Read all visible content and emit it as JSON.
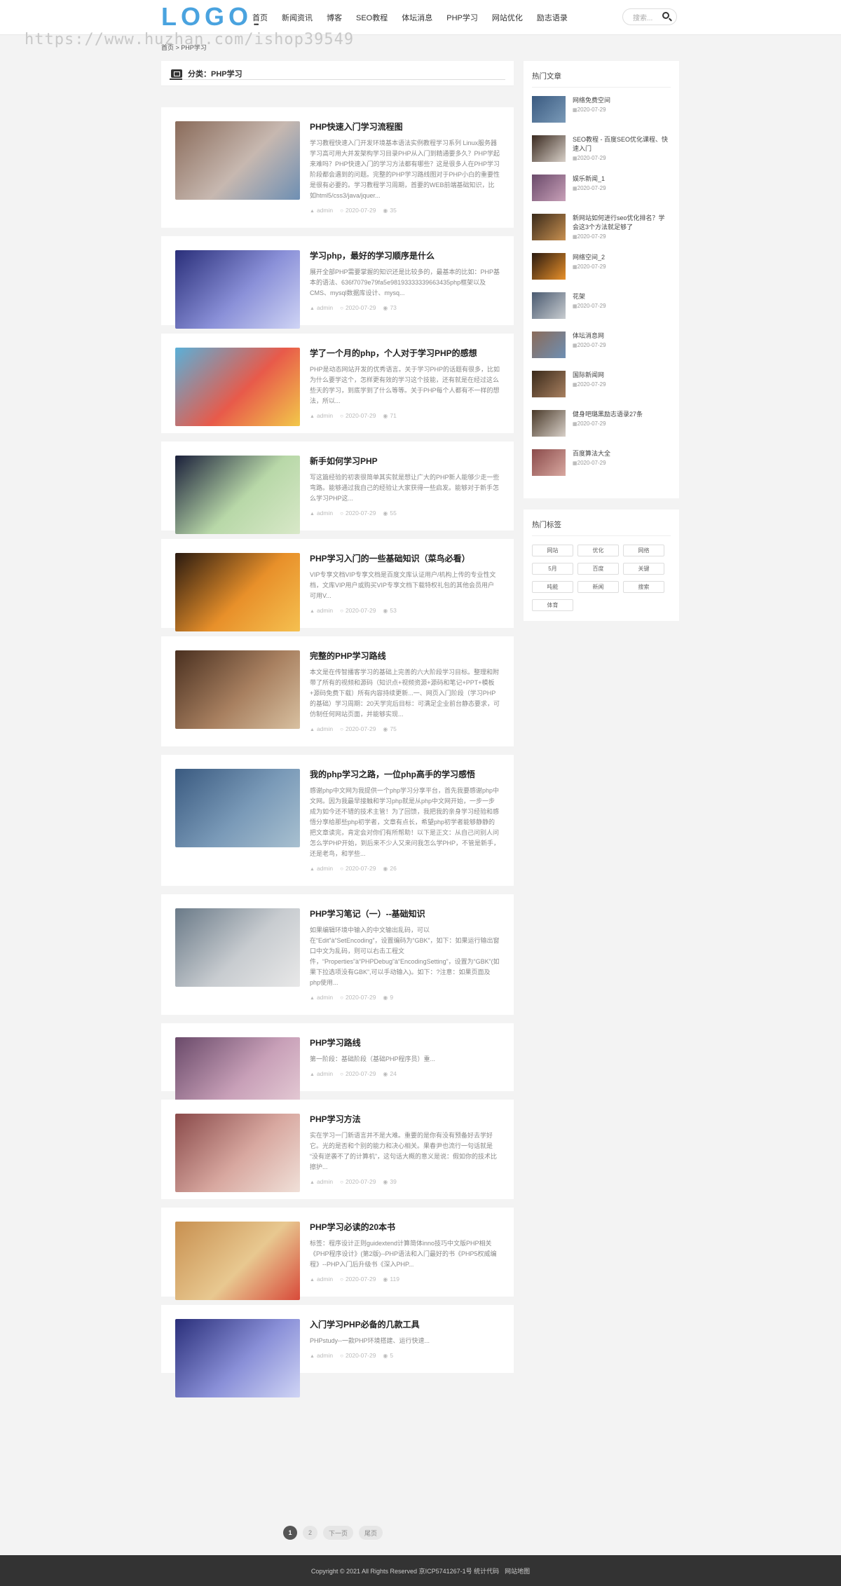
{
  "header": {
    "logo": "LOGO",
    "nav": [
      "首页",
      "新闻资讯",
      "博客",
      "SEO教程",
      "体坛消息",
      "PHP学习",
      "网站优化",
      "励志语录"
    ],
    "search_placeholder": "搜索..."
  },
  "watermark": "https://www.huzhan.com/ishop39549",
  "breadcrumb": "首页 > PHP学习",
  "category": {
    "title": "分类：PHP学习"
  },
  "posts": [
    {
      "title": "PHP快速入门学习流程图",
      "excerpt": "学习教程快速入门开发环境基本语法实例教程学习系列 Linux服务器学习高可用大并发架构学习目录PHP从入门到精通要多久？PHP学起来难吗？PHP快速入门的学习方法都有哪些？这是很多人在PHP学习阶段都会遇到的问题。完整的PHP学习路线图对于PHP小白的重要性是很有必要的。学习教程学习周期，首要的WEB前端基础知识，比如html5/css3/java/jquer...",
      "author": "admin",
      "date": "2020-07-29",
      "views": "35",
      "colors": [
        "#8a6b5a",
        "#c7b8b0",
        "#6e8fb3"
      ]
    },
    {
      "title": "学习php，最好的学习顺序是什么",
      "excerpt": "展开全部PHP需要掌握的知识还是比较多的，最基本的比如：PHP基本的语法、636f7079e79fa5e98193333339663435php框架以及CMS、mysql数据库设计、mysq...",
      "author": "admin",
      "date": "2020-07-29",
      "views": "73",
      "colors": [
        "#2a2f7a",
        "#8a90d8",
        "#cfd4f5"
      ]
    },
    {
      "title": "学了一个月的php，个人对于学习PHP的感想",
      "excerpt": "PHP是动态网站开发的优秀语言。关于学习PHP的话题有很多，比如为什么要学这个，怎样更有效的学习这个技能，还有就是在经过这么些天的学习，到底学到了什么等等。关于PHP每个人都有不一样的想法，所以...",
      "author": "admin",
      "date": "2020-07-29",
      "views": "71",
      "colors": [
        "#5ab0d8",
        "#e85a4a",
        "#f2c84a"
      ]
    },
    {
      "title": "新手如何学习PHP",
      "excerpt": "写这篇经验的初衷很简单其实就是想让广大的PHP新人能够少走一些弯路。能够通过我自己的经验让大家获得一些启发。能够对于新手怎么学习PHP这...",
      "author": "admin",
      "date": "2020-07-29",
      "views": "55",
      "colors": [
        "#1a1f3a",
        "#b8d8a8",
        "#d8e8c8"
      ]
    },
    {
      "title": "PHP学习入门的一些基础知识（菜鸟必看）",
      "excerpt": "VIP专享文档VIP专享文档是百度文库认证用户/机构上传的专业性文档，文库VIP用户或购买VIP专享文档下载特权礼包的其他会员用户可用V...",
      "author": "admin",
      "date": "2020-07-29",
      "views": "53",
      "colors": [
        "#2a1a10",
        "#e8902a",
        "#f5c050"
      ]
    },
    {
      "title": "完整的PHP学习路线",
      "excerpt": "本文是在传智播客学习的基础上完善的六大阶段学习目标。整理和附带了所有的视频和源码（知识点+视频资源+源码和笔记+PPT+模板+源码免费下载）所有内容持续更新...一、网页入门阶段（学习PHP的基础）学习周期：20天学完后目标：可满足企业前台静态要求，可仿制任何网站页面，并能够实现...",
      "author": "admin",
      "date": "2020-07-29",
      "views": "75",
      "colors": [
        "#4a3020",
        "#a88060",
        "#d8c0a0"
      ]
    },
    {
      "title": "我的php学习之路，一位php高手的学习感悟",
      "excerpt": "感谢php中文网为我提供一个php学习分享平台，首先我要感谢php中文网。因为我最早接触和学习php就是从php中文网开始，一步一步成为如今还不错的技术主管！为了回馈，我把我的亲身学习经验和感悟分享给那些php初学者，文章有点长，希望php初学者能够静静的把文章读完，肯定会对你们有所帮助！以下是正文：从自己问别人问怎么学PHP开始，到后来不少人又来问我怎么学PHP，不管是新手，还是老鸟，和学些...",
      "author": "admin",
      "date": "2020-07-29",
      "views": "26",
      "colors": [
        "#3a5a80",
        "#7a9ab8",
        "#a8c0d0"
      ]
    },
    {
      "title": "PHP学习笔记（一）--基础知识",
      "excerpt": "如果编辑环境中输入的中文输出乱码，可以在“Edit”à“SetEncoding”，设置编码为“GBK”，如下：如果运行输出窗口中文为乱码，则可以右击工程文件，“Properties”à“PHPDebug”à“EncodingSetting”，设置为“GBK”(如果下拉选项没有GBK”,可以手动输入)。如下：?注意：如果页面及php使用...",
      "author": "admin",
      "date": "2020-07-29",
      "views": "9",
      "colors": [
        "#6a7a88",
        "#c8ccd0",
        "#e8e8e8"
      ]
    },
    {
      "title": "PHP学习路线",
      "excerpt": "第一阶段：基础阶段（基础PHP程序员）重...",
      "author": "admin",
      "date": "2020-07-29",
      "views": "24",
      "colors": [
        "#6a4a6a",
        "#c8a0b8",
        "#e8d0d8"
      ]
    },
    {
      "title": "PHP学习方法",
      "excerpt": "实在学习一门新语言并不是大难。重要的是你有没有预备好去学好它。光的是否和个别的能力和决心相关。果春尹也流行一句话就是 “没有逆袭不了的计算机”，这句话大概的意义是说：假如你的技术比擦护...",
      "author": "admin",
      "date": "2020-07-29",
      "views": "39",
      "colors": [
        "#8a4a4a",
        "#d8a8a0",
        "#f0e0d8"
      ]
    },
    {
      "title": "PHP学习必读的20本书",
      "excerpt": "标签：程序设计正则guidextend计算简体inno技巧中文版PHP相关《PHP程序设计》(第2版)--PHP语法和入门最好的书《PHP5权威编程》--PHP入门后升级书《深入PHP...",
      "author": "admin",
      "date": "2020-07-29",
      "views": "119",
      "colors": [
        "#c89050",
        "#e8c890",
        "#d84a3a"
      ]
    },
    {
      "title": "入门学习PHP必备的几款工具",
      "excerpt": "PHPstudy--一款PHP环境搭建、运行快速...",
      "author": "admin",
      "date": "2020-07-29",
      "views": "5",
      "colors": [
        "#2a2f7a",
        "#8a90d8",
        "#cfd4f5"
      ]
    }
  ],
  "pagination": [
    "1",
    "2",
    "下一页",
    "尾页"
  ],
  "sidebar": {
    "hot_title": "热门文章",
    "hot_items": [
      {
        "title": "网络免费空间",
        "date": "2020-07-29",
        "colors": [
          "#3a5a80",
          "#7a9ab8"
        ]
      },
      {
        "title": "SEO教程 - 百度SEO优化课程、快速入门",
        "date": "2020-07-29",
        "colors": [
          "#3a2a20",
          "#d8d0c8"
        ]
      },
      {
        "title": "娱乐新闻_1",
        "date": "2020-07-29",
        "colors": [
          "#6a4a6a",
          "#c8a0b8"
        ]
      },
      {
        "title": "新网站如何进行seo优化排名？学会这3个方法就足够了",
        "date": "2020-07-29",
        "colors": [
          "#3a2a1a",
          "#c89050"
        ]
      },
      {
        "title": "网络空间_2",
        "date": "2020-07-29",
        "colors": [
          "#2a1a10",
          "#e8902a"
        ]
      },
      {
        "title": "花架",
        "date": "2020-07-29",
        "colors": [
          "#4a5a70",
          "#c8ccd0"
        ]
      },
      {
        "title": "体坛消息网",
        "date": "2020-07-29",
        "colors": [
          "#8a6b5a",
          "#6e8fb3"
        ]
      },
      {
        "title": "国际新闻网",
        "date": "2020-07-29",
        "colors": [
          "#3a2a1a",
          "#a88060"
        ]
      },
      {
        "title": "健身吧璐黑励志语录27条",
        "date": "2020-07-29",
        "colors": [
          "#4a3a2a",
          "#d8d0c8"
        ]
      },
      {
        "title": "百度算法大全",
        "date": "2020-07-29",
        "colors": [
          "#8a4a4a",
          "#d8a8a0"
        ]
      }
    ],
    "tags_title": "热门标签",
    "tags": [
      "网站",
      "优化",
      "网络",
      "5月",
      "百度",
      "关键",
      "吨能",
      "新闻",
      "搜索",
      "体育"
    ]
  },
  "footer": {
    "copyright": "Copyright © 2021 All Rights Reserved 京ICP5741267-1号 统计代码",
    "sitemap": "网站地图"
  }
}
